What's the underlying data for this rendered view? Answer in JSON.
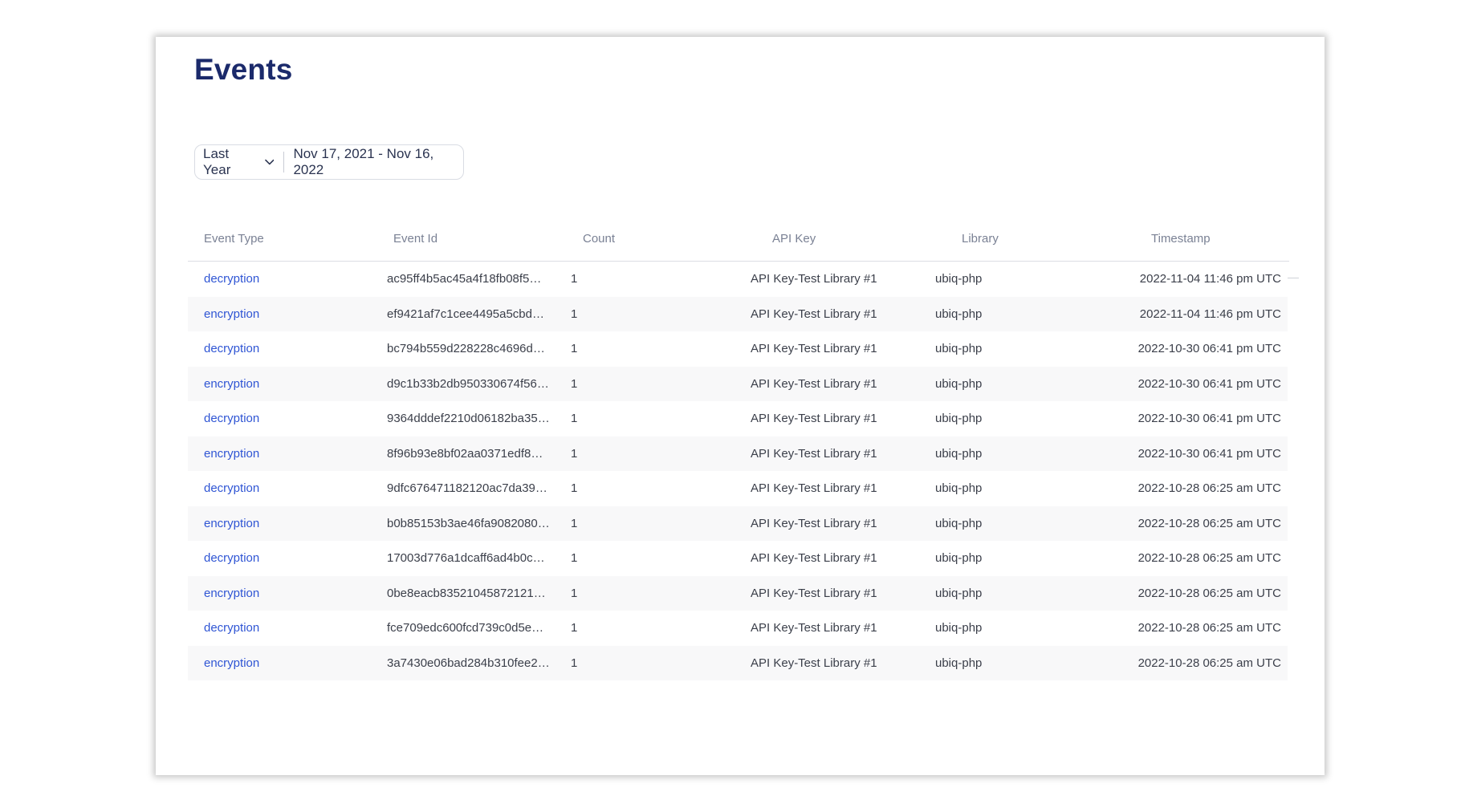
{
  "page": {
    "title": "Events"
  },
  "filter": {
    "range_label": "Last Year",
    "date_range": "Nov 17, 2021 - Nov 16, 2022"
  },
  "table": {
    "columns": [
      "Event Type",
      "Event Id",
      "Count",
      "API Key",
      "Library",
      "Timestamp"
    ],
    "rows": [
      {
        "type": "decryption",
        "event_id": "ac95ff4b5ac45a4f18fb08f5…",
        "count": "1",
        "api_key": "API Key-Test Library #1",
        "library": "ubiq-php",
        "timestamp": "2022-11-04 11:46 pm UTC"
      },
      {
        "type": "encryption",
        "event_id": "ef9421af7c1cee4495a5cbd…",
        "count": "1",
        "api_key": "API Key-Test Library #1",
        "library": "ubiq-php",
        "timestamp": "2022-11-04 11:46 pm UTC"
      },
      {
        "type": "decryption",
        "event_id": "bc794b559d228228c4696d…",
        "count": "1",
        "api_key": "API Key-Test Library #1",
        "library": "ubiq-php",
        "timestamp": "2022-10-30 06:41 pm UTC"
      },
      {
        "type": "encryption",
        "event_id": "d9c1b33b2db950330674f56…",
        "count": "1",
        "api_key": "API Key-Test Library #1",
        "library": "ubiq-php",
        "timestamp": "2022-10-30 06:41 pm UTC"
      },
      {
        "type": "decryption",
        "event_id": "9364dddef2210d06182ba35…",
        "count": "1",
        "api_key": "API Key-Test Library #1",
        "library": "ubiq-php",
        "timestamp": "2022-10-30 06:41 pm UTC"
      },
      {
        "type": "encryption",
        "event_id": "8f96b93e8bf02aa0371edf8…",
        "count": "1",
        "api_key": "API Key-Test Library #1",
        "library": "ubiq-php",
        "timestamp": "2022-10-30 06:41 pm UTC"
      },
      {
        "type": "decryption",
        "event_id": "9dfc676471182120ac7da39…",
        "count": "1",
        "api_key": "API Key-Test Library #1",
        "library": "ubiq-php",
        "timestamp": "2022-10-28 06:25 am UTC"
      },
      {
        "type": "encryption",
        "event_id": "b0b85153b3ae46fa9082080…",
        "count": "1",
        "api_key": "API Key-Test Library #1",
        "library": "ubiq-php",
        "timestamp": "2022-10-28 06:25 am UTC"
      },
      {
        "type": "decryption",
        "event_id": "17003d776a1dcaff6ad4b0c…",
        "count": "1",
        "api_key": "API Key-Test Library #1",
        "library": "ubiq-php",
        "timestamp": "2022-10-28 06:25 am UTC"
      },
      {
        "type": "encryption",
        "event_id": "0be8eacb83521045872121…",
        "count": "1",
        "api_key": "API Key-Test Library #1",
        "library": "ubiq-php",
        "timestamp": "2022-10-28 06:25 am UTC"
      },
      {
        "type": "decryption",
        "event_id": "fce709edc600fcd739c0d5e…",
        "count": "1",
        "api_key": "API Key-Test Library #1",
        "library": "ubiq-php",
        "timestamp": "2022-10-28 06:25 am UTC"
      },
      {
        "type": "encryption",
        "event_id": "3a7430e06bad284b310fee2…",
        "count": "1",
        "api_key": "API Key-Test Library #1",
        "library": "ubiq-php",
        "timestamp": "2022-10-28 06:25 am UTC"
      }
    ]
  },
  "colors": {
    "title": "#1b2a6b",
    "link": "#2f55d4",
    "row_stripe": "#f8f8f9",
    "header_text": "#7a8194"
  },
  "icons": {
    "range_dropdown": "chevron-down-icon"
  }
}
